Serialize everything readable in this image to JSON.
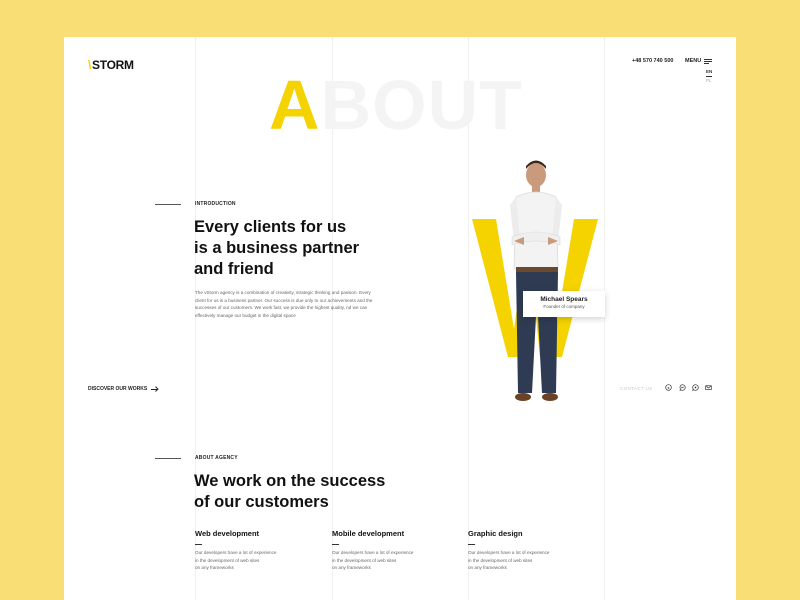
{
  "header": {
    "logo_slash": "\\",
    "logo_text": "STORM",
    "phone": "+48 570 740 500",
    "menu_label": "MENU",
    "languages": [
      "EN",
      "PL"
    ]
  },
  "hero": {
    "first_letter": "A",
    "rest": "BOUT"
  },
  "intro": {
    "eyebrow": "INTRODUCTION",
    "headline_lines": [
      "Every clients for us",
      "is a business partner",
      "and friend"
    ],
    "body_lines": [
      "The vStorm agency is a combination of creativity, strategic thinking and passion. Every",
      "client for us is a business partner. Our success is due only to our achievements and the",
      "successes of our customers. We work fast, we provide the highest quality, nd we can",
      "effectively manage our budget in the digital space"
    ]
  },
  "person": {
    "name": "Michael Spears",
    "role": "Founder of company"
  },
  "discover": {
    "label": "DISCOVER OUR WORKS"
  },
  "contact": {
    "label": "CONTACT US",
    "icons": [
      "skype-icon",
      "messenger-icon",
      "whatsapp-icon",
      "mail-icon"
    ]
  },
  "agency": {
    "eyebrow": "ABOUT AGENCY",
    "headline_lines": [
      "We work on the success",
      "of our customers"
    ]
  },
  "services": [
    {
      "title": "Web development",
      "desc_lines": [
        "Our developers have a lot of experience",
        "in the development of web sites",
        "on any frameworks"
      ]
    },
    {
      "title": "Mobile development",
      "desc_lines": [
        "Our developers have a lot of experience",
        "in the development of web sites",
        "on any frameworks"
      ]
    },
    {
      "title": "Graphic design",
      "desc_lines": [
        "Our developers have a lot of experience",
        "in the development of web sites",
        "on any frameworks"
      ]
    }
  ],
  "colors": {
    "background": "#f8de74",
    "accent": "#f5d300",
    "page": "#ffffff"
  }
}
